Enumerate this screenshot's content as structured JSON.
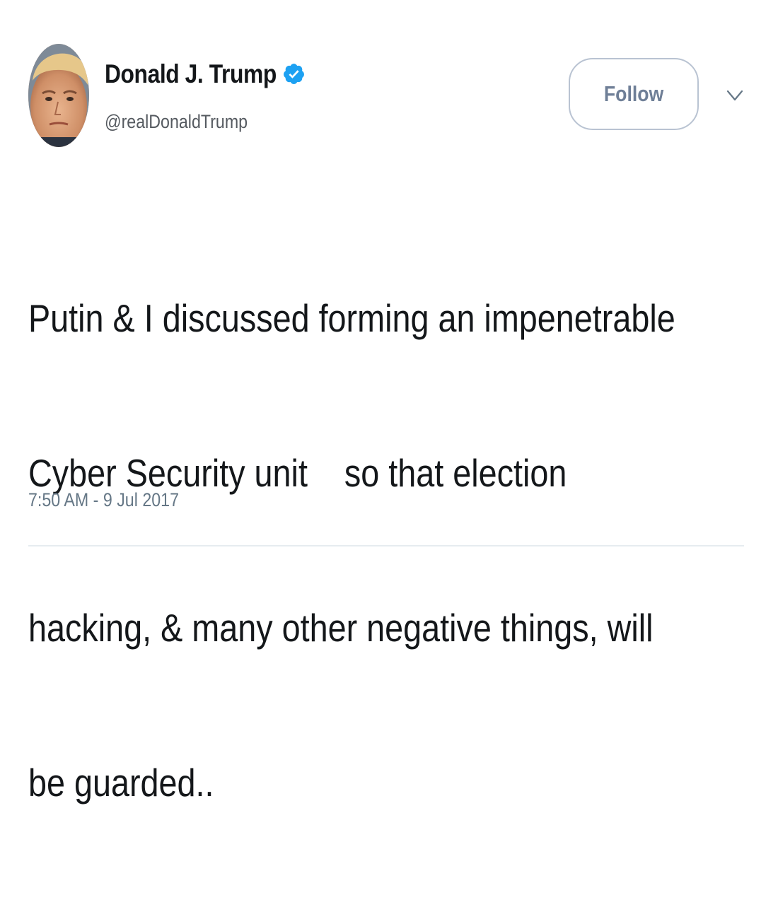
{
  "user": {
    "display_name": "Donald J. Trump",
    "handle": "@realDonaldTrump",
    "verified": true
  },
  "follow_button": {
    "label": "Follow"
  },
  "tweet": {
    "lines": [
      "Putin & I discussed forming an impenetrable",
      "Cyber Security unit    so that election",
      "hacking, & many other negative things, will",
      "be guarded.."
    ],
    "timestamp": "7:50 AM - 9 Jul 2017"
  },
  "colors": {
    "verified_badge": "#1da1f2",
    "follow_border": "#b9c3d2",
    "follow_text": "#6f7f97",
    "body_text": "#14171a",
    "meta_text": "#657786"
  },
  "icons": {
    "verified": "verified-badge-icon",
    "menu": "chevron-down-icon"
  }
}
